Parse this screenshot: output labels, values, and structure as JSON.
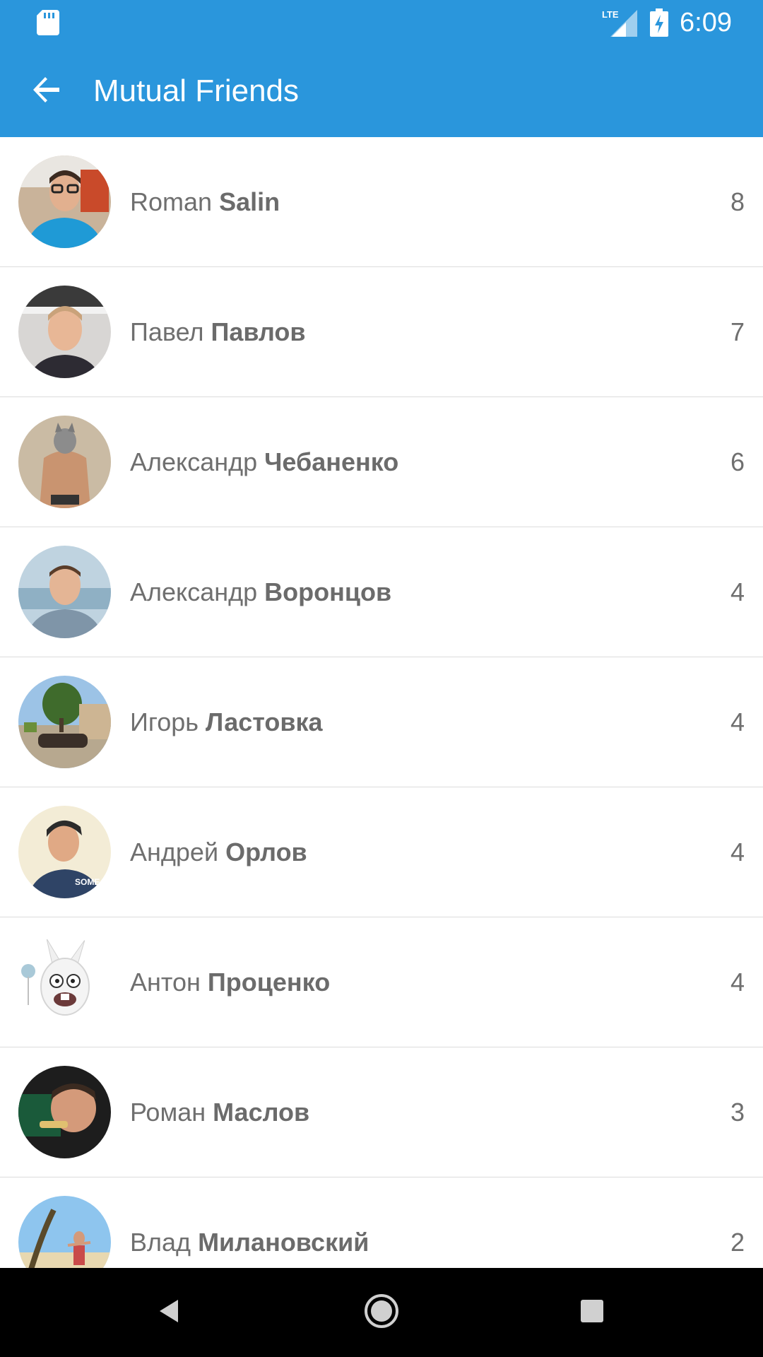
{
  "status_bar": {
    "time": "6:09",
    "network": "LTE",
    "icons": [
      "sd-card-icon",
      "lte-signal-icon",
      "battery-charging-icon"
    ]
  },
  "app_bar": {
    "title": "Mutual Friends",
    "back_icon": "arrow-back-icon"
  },
  "friends": [
    {
      "first": "Roman",
      "last": "Salin",
      "count": "8"
    },
    {
      "first": "Павел",
      "last": "Павлов",
      "count": "7"
    },
    {
      "first": "Александр",
      "last": "Чебаненко",
      "count": "6"
    },
    {
      "first": "Александр",
      "last": "Воронцов",
      "count": "4"
    },
    {
      "first": "Игорь",
      "last": "Ластовка",
      "count": "4"
    },
    {
      "first": "Андрей",
      "last": "Орлов",
      "count": "4"
    },
    {
      "first": "Антон",
      "last": "Проценко",
      "count": "4"
    },
    {
      "first": "Роман",
      "last": "Маслов",
      "count": "3"
    },
    {
      "first": "Влад",
      "last": "Милановский",
      "count": "2"
    }
  ],
  "nav_bar": {
    "back": "nav-back-icon",
    "home": "nav-home-icon",
    "recents": "nav-recents-icon"
  },
  "colors": {
    "primary": "#2a96dc",
    "text": "#6f6f6f",
    "divider": "#dcdcdc"
  }
}
